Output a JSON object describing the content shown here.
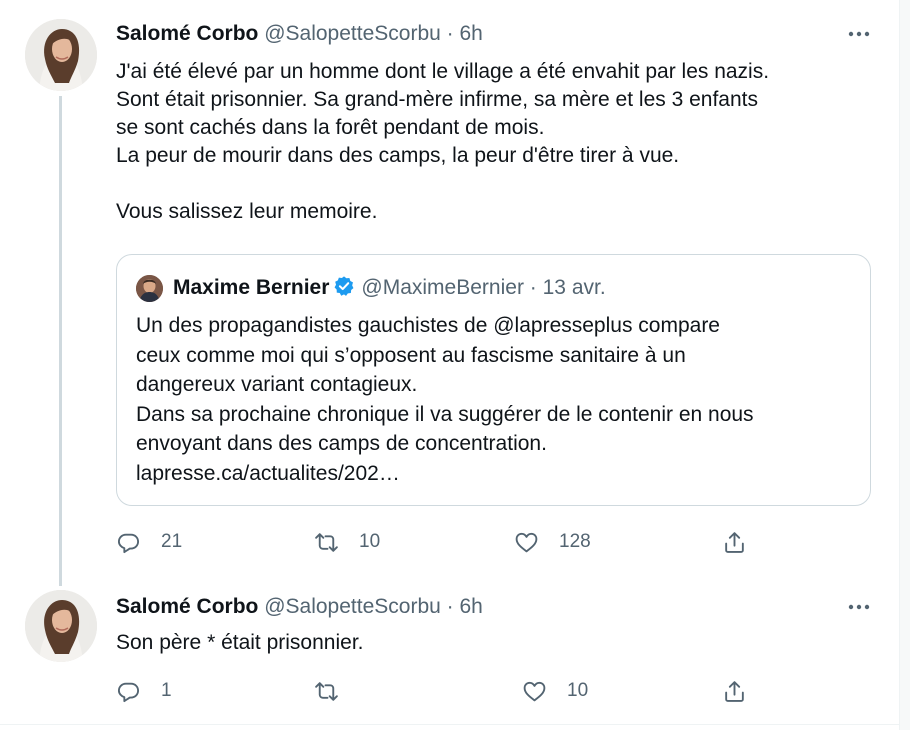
{
  "tweets": [
    {
      "author": "Salomé Corbo",
      "handle": "@SalopetteScorbu",
      "separator": "·",
      "time": "6h",
      "lines": [
        "J'ai été élevé par un homme dont le village a été envahit par les nazis.",
        "Sont était prisonnier. Sa grand-mère infirme, sa mère et les 3 enfants",
        "se sont cachés dans la forêt pendant de mois.",
        "La peur de mourir dans des camps, la peur d'être tirer à vue.",
        "",
        "Vous salissez leur memoire."
      ],
      "quote": {
        "author": "Maxime Bernier",
        "handle": "@MaximeBernier",
        "separator": "·",
        "date": "13 avr.",
        "lines": [
          "Un des propagandistes gauchistes de @lapresseplus compare",
          "ceux comme moi qui s’opposent au fascisme sanitaire à un",
          "dangereux variant contagieux.",
          "Dans sa prochaine chronique il va suggérer de le contenir en nous",
          "envoyant dans des camps de concentration.",
          "lapresse.ca/actualites/202…"
        ]
      },
      "actions": {
        "replies": "21",
        "retweets": "10",
        "likes": "128"
      }
    },
    {
      "author": "Salomé Corbo",
      "handle": "@SalopetteScorbu",
      "separator": "·",
      "time": "6h",
      "lines": [
        "Son père * était prisonnier."
      ],
      "actions": {
        "replies": "1",
        "retweets": "",
        "likes": "10"
      }
    }
  ],
  "icons": {
    "more": "more-horizontal-icon",
    "reply": "reply-icon",
    "retweet": "retweet-icon",
    "like": "heart-icon",
    "share": "share-icon",
    "verified": "verified-badge-icon"
  },
  "colors": {
    "text": "#0f1419",
    "muted": "#536471",
    "border": "#cfd9de",
    "verified": "#1d9bf0"
  }
}
